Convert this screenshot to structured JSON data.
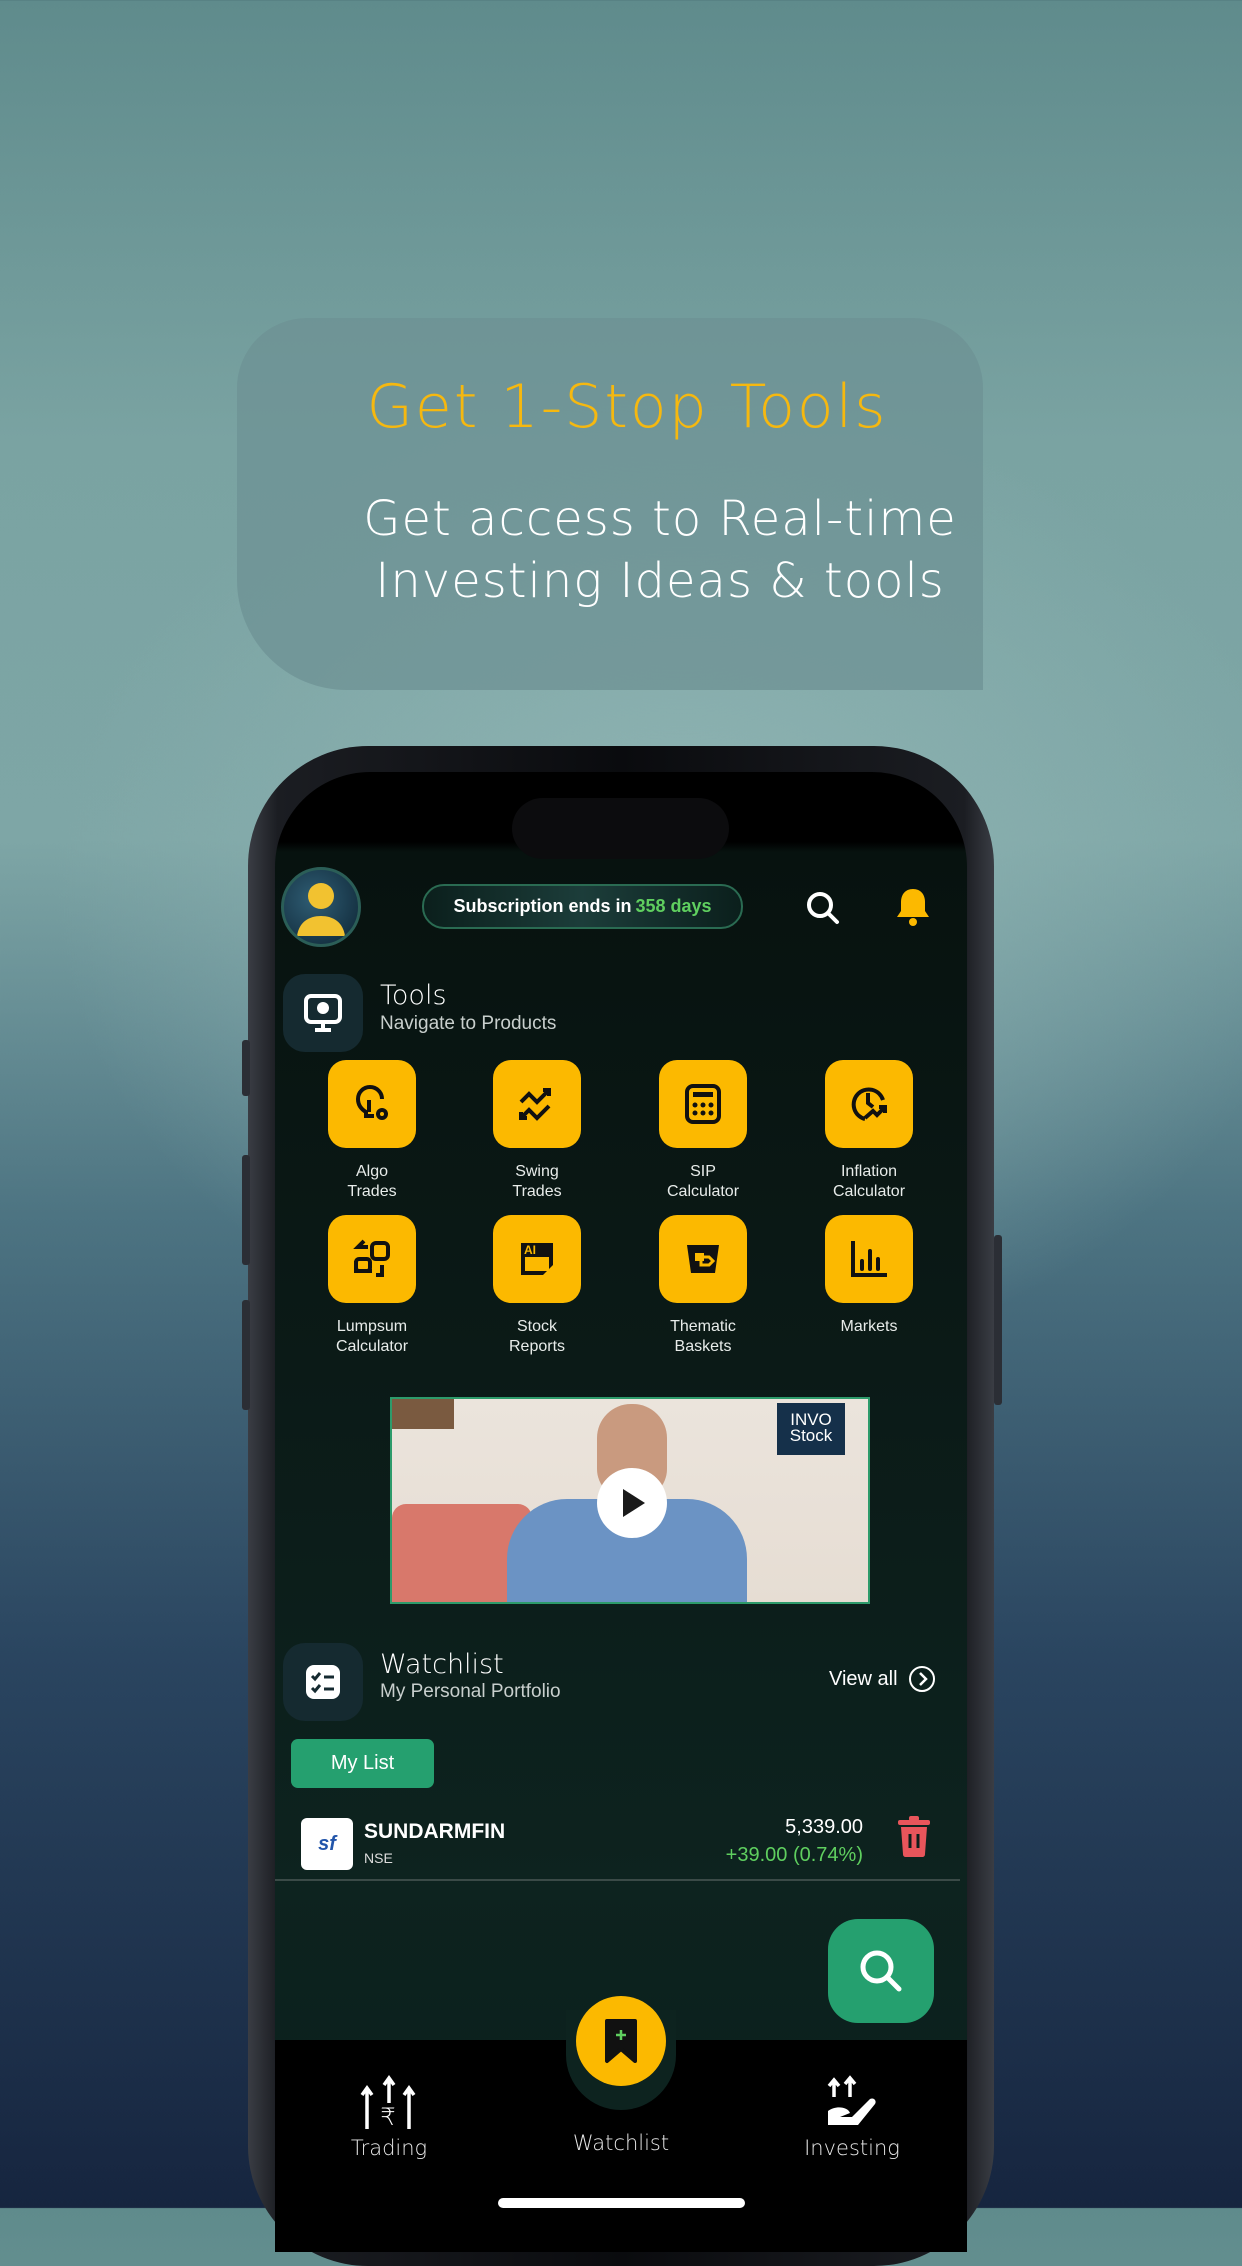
{
  "promo": {
    "title": "Get 1-Stop Tools",
    "subtitle_line1": "Get access to Real-time",
    "subtitle_line2": "Investing Ideas & tools"
  },
  "colors": {
    "accent_yellow": "#fcb900",
    "accent_green": "#25a06f",
    "positive": "#5fcf5f",
    "danger": "#e8555b"
  },
  "header": {
    "subscription_prefix": "Subscription ends in",
    "subscription_days": "358 days",
    "icons": [
      "avatar",
      "search-icon",
      "bell-icon"
    ]
  },
  "tools": {
    "title": "Tools",
    "subtitle": "Navigate to Products",
    "items": [
      {
        "label": "Algo\nTrades",
        "icon": "lightbulb-gear-icon"
      },
      {
        "label": "Swing\nTrades",
        "icon": "swing-arrows-icon"
      },
      {
        "label": "SIP\nCalculator",
        "icon": "calculator-icon"
      },
      {
        "label": "Inflation\nCalculator",
        "icon": "clock-trend-icon"
      },
      {
        "label": "Lumpsum\nCalculator",
        "icon": "exchange-icon"
      },
      {
        "label": "Stock\nReports",
        "icon": "ai-note-icon"
      },
      {
        "label": "Thematic\nBaskets",
        "icon": "basket-tag-icon"
      },
      {
        "label": "Markets",
        "icon": "bar-chart-icon"
      }
    ]
  },
  "video": {
    "logo_line1": "INVO",
    "logo_line2": "Stock"
  },
  "watchlist": {
    "title": "Watchlist",
    "subtitle": "My Personal Portfolio",
    "view_all": "View all",
    "tab": "My List",
    "rows": [
      {
        "symbol": "SUNDARMFIN",
        "exchange": "NSE",
        "logo_text": "sf",
        "price": "5,339.00",
        "change": "+39.00 (0.74%)"
      }
    ]
  },
  "nav": {
    "items": [
      {
        "label": "Trading"
      },
      {
        "label": "Watchlist"
      },
      {
        "label": "Investing"
      }
    ]
  }
}
